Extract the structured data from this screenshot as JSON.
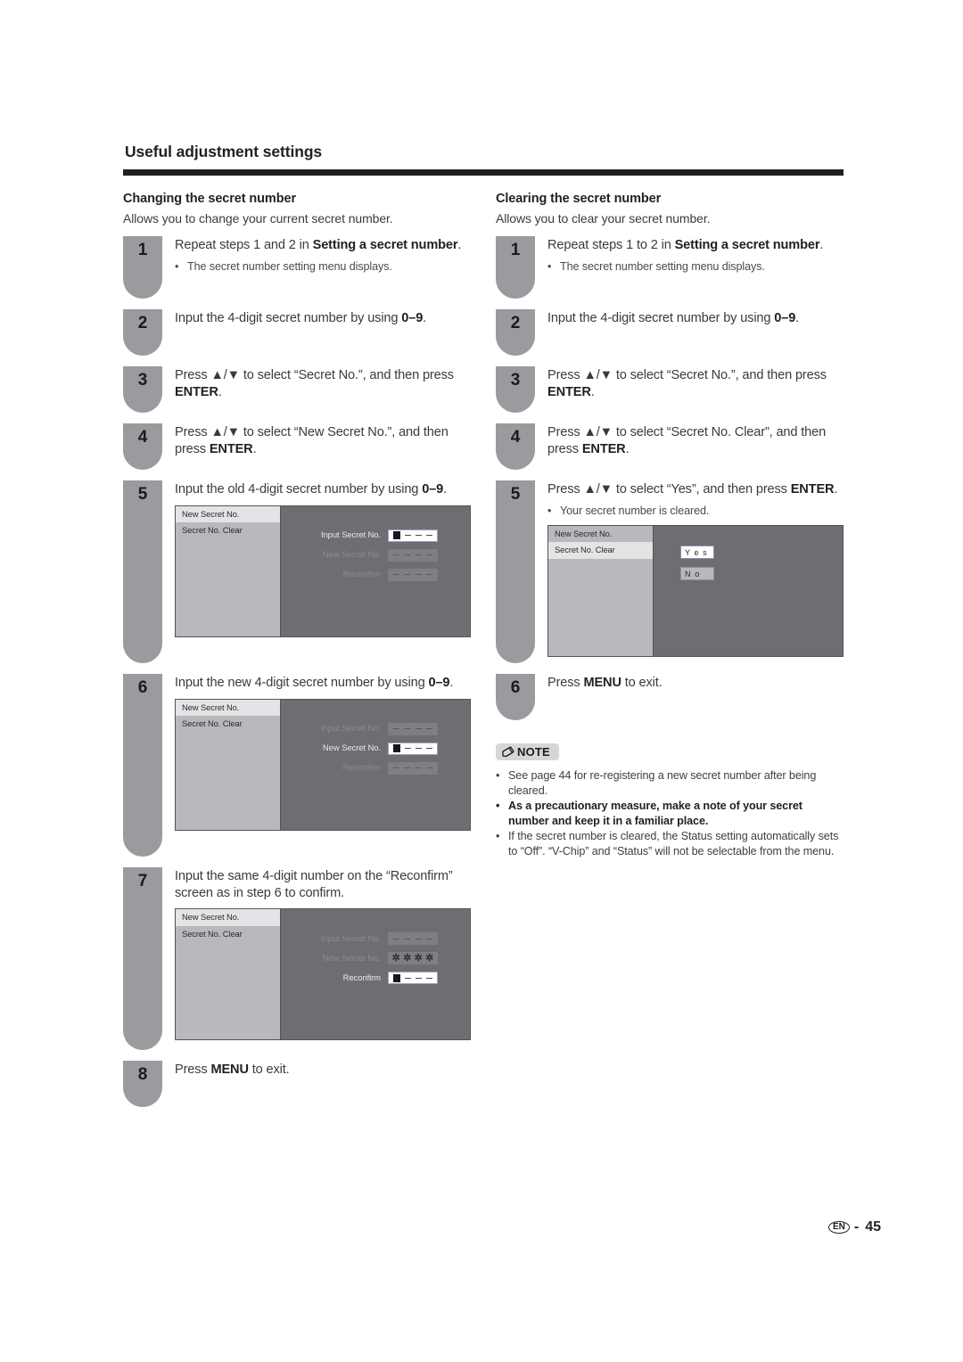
{
  "header": {
    "title": "Useful adjustment settings"
  },
  "left_section": {
    "title": "Changing the secret number",
    "description": "Allows you to change your current secret number.",
    "steps": [
      {
        "num": "1",
        "text_pre": "Repeat steps 1 and 2 in ",
        "text_bold": "Setting a secret number",
        "text_post": ".",
        "bullet": "The secret number setting menu displays."
      },
      {
        "num": "2",
        "text_pre": "Input the 4-digit secret number by using ",
        "text_bold": "0–9",
        "text_post": "."
      },
      {
        "num": "3",
        "text_pre": "Press ▲/▼ to select “Secret No.”, and then press ",
        "text_bold": "ENTER",
        "text_post": "."
      },
      {
        "num": "4",
        "text_pre": "Press ▲/▼ to select “New Secret No.”, and then press ",
        "text_bold": "ENTER",
        "text_post": "."
      },
      {
        "num": "5",
        "text_pre": "Input the old 4-digit secret number by using ",
        "text_bold": "0–9",
        "text_post": "."
      },
      {
        "num": "6",
        "text_pre": "Input the new 4-digit secret number by using ",
        "text_bold": "0–9",
        "text_post": "."
      },
      {
        "num": "7",
        "text_pre": "Input the same 4-digit number on the “Reconfirm” screen as in step 6 to confirm.",
        "text_bold": "",
        "text_post": ""
      },
      {
        "num": "8",
        "text_pre": "Press ",
        "text_bold": "MENU",
        "text_post": " to exit."
      }
    ]
  },
  "right_section": {
    "title": "Clearing the secret number",
    "description": "Allows you to clear your secret number.",
    "steps": [
      {
        "num": "1",
        "text_pre": "Repeat steps 1 to 2 in ",
        "text_bold": "Setting a secret number",
        "text_post": ".",
        "bullet": "The secret number setting menu displays."
      },
      {
        "num": "2",
        "text_pre": "Input the 4-digit secret number by using ",
        "text_bold": "0–9",
        "text_post": "."
      },
      {
        "num": "3",
        "text_pre": "Press ▲/▼ to select “Secret No.”, and then press ",
        "text_bold": "ENTER",
        "text_post": "."
      },
      {
        "num": "4",
        "text_pre": "Press ▲/▼ to select “Secret No. Clear”, and then press ",
        "text_bold": "ENTER",
        "text_post": "."
      },
      {
        "num": "5",
        "text_pre": "Press ▲/▼ to select “Yes”, and then press ",
        "text_bold": "ENTER",
        "text_post": ".",
        "bullet": "Your secret number is cleared."
      },
      {
        "num": "6",
        "text_pre": "Press ",
        "text_bold": "MENU",
        "text_post": " to exit."
      }
    ]
  },
  "osd": {
    "menu_items": [
      "New Secret No.",
      "Secret No. Clear"
    ],
    "field_labels": [
      "Input Secret No.",
      "New Secret No.",
      "Reconfirm"
    ],
    "choices": [
      "Y e s",
      "N o"
    ],
    "screen_1_active_field": "Input Secret No.",
    "screen_2_active_field": "New Secret No.",
    "screen_3_active_field": "Reconfirm",
    "screen_3_filled_field": "New Secret No.",
    "screen_3_filled_value": "✲✲✲✲",
    "clear_screen_active_menu": "Secret No. Clear",
    "clear_screen_active_choice": "Y e s"
  },
  "note": {
    "label": "NOTE",
    "items": [
      {
        "text": "See page 44 for re-registering a new secret number after being cleared.",
        "bold": false
      },
      {
        "text": "As a precautionary measure, make a note of your secret number and keep it in a familiar place.",
        "bold": true
      },
      {
        "text": "If the secret number is cleared, the Status setting automatically sets to “Off”. “V-Chip” and “Status” will not be selectable from the menu.",
        "bold": false
      }
    ]
  },
  "footer": {
    "language": "EN",
    "separator": "-",
    "page_number": "45"
  }
}
